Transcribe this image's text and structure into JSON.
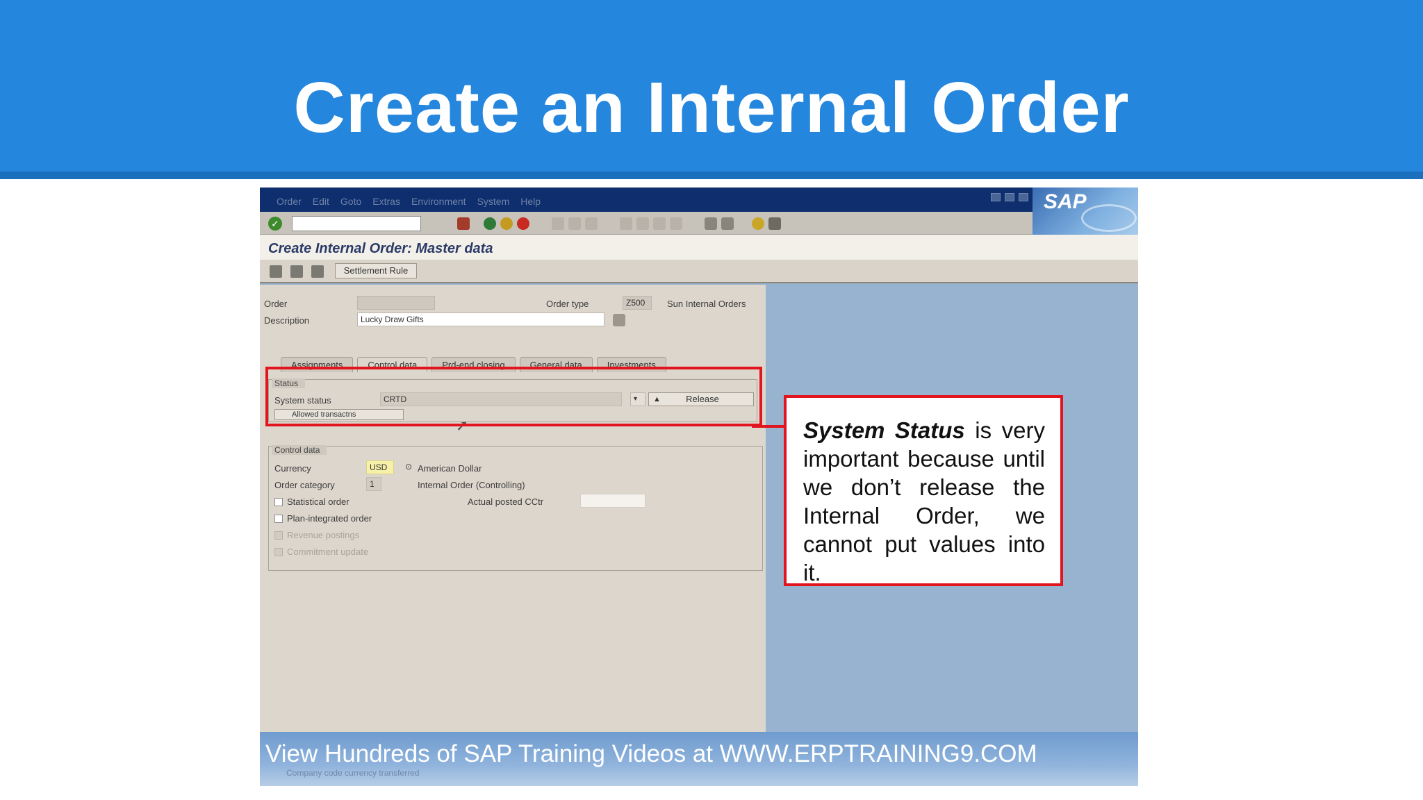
{
  "slide": {
    "title": "Create an Internal Order",
    "banner_color": "#2586dd"
  },
  "sap": {
    "menu": [
      "Order",
      "Edit",
      "Goto",
      "Extras",
      "Environment",
      "System",
      "Help"
    ],
    "logo": "SAP",
    "screen_title": "Create Internal Order: Master data",
    "settlement_rule_button": "Settlement Rule",
    "header": {
      "order_label": "Order",
      "order_value": "",
      "description_label": "Description",
      "description_value": "Lucky Draw Gifts",
      "order_type_label": "Order type",
      "order_type_value": "Z500",
      "order_type_text": "Sun Internal Orders"
    },
    "tabs": [
      "Assignments",
      "Control data",
      "Prd-end closing",
      "General data",
      "Investments"
    ],
    "status": {
      "group_title": "Status",
      "system_status_label": "System status",
      "system_status_value": "CRTD",
      "release_button": "Release",
      "allowed_transactions_button": "Allowed transactns"
    },
    "control_data": {
      "group_title": "Control data",
      "currency_label": "Currency",
      "currency_value": "USD",
      "currency_text": "American Dollar",
      "order_category_label": "Order category",
      "order_category_value": "1",
      "order_category_text": "Internal Order (Controlling)",
      "statistical_order_label": "Statistical order",
      "actual_posted_label": "Actual posted CCtr",
      "plan_integrated_label": "Plan-integrated order",
      "revenue_postings_label": "Revenue postings",
      "commitment_update_label": "Commitment update"
    },
    "bottom_banner": "View Hundreds of SAP Training Videos at WWW.ERPTRAINING9.COM",
    "status_message": "Company code currency transferred"
  },
  "callout": {
    "bold_phrase": "System Status",
    "text": " is very important because until we don’t release the Internal Order, we cannot put values into it.",
    "border_color": "#e2141d"
  }
}
